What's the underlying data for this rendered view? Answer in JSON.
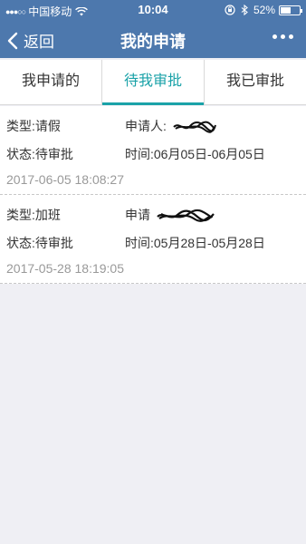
{
  "status_bar": {
    "signal_dots": "●●●○○",
    "carrier": "中国移动",
    "time": "10:04",
    "battery_percent": "52%",
    "battery_level": 0.52
  },
  "nav": {
    "back_label": "返回",
    "title": "我的申请"
  },
  "tabs": [
    {
      "label": "我申请的"
    },
    {
      "label": "待我审批"
    },
    {
      "label": "我已审批"
    }
  ],
  "active_tab_index": 1,
  "accent_color": "#1aa2a8",
  "header_color": "#4d78ad",
  "items": [
    {
      "type": "类型:请假",
      "applicant": "申请人:",
      "status": "状态:待审批",
      "time_range": "时间:06月05日-06月05日",
      "created": "2017-06-05 18:08:27"
    },
    {
      "type": "类型:加班",
      "applicant": "申请",
      "status": "状态:待审批",
      "time_range": "时间:05月28日-05月28日",
      "created": "2017-05-28 18:19:05"
    }
  ]
}
